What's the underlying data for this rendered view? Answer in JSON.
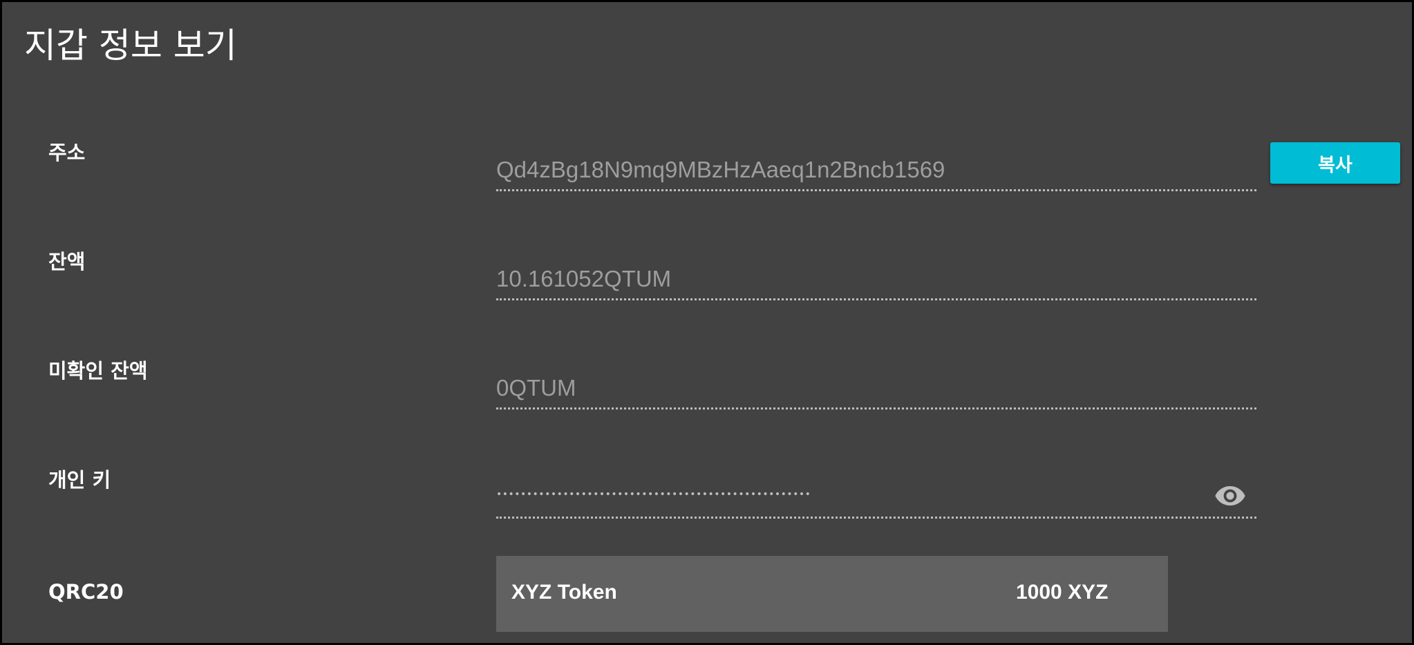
{
  "page": {
    "title": "지갑 정보 보기"
  },
  "address": {
    "label": "주소",
    "value": "Qd4zBg18N9mq9MBzHzAaeq1n2Bncb1569",
    "copy_label": "복사"
  },
  "balance": {
    "label": "잔액",
    "value": "10.161052QTUM"
  },
  "unconfirmed_balance": {
    "label": "미확인 잔액",
    "value": "0QTUM"
  },
  "private_key": {
    "label": "개인 키",
    "masked_value": "••••••••••••••••••••••••••••••••••••••••••••••••••••",
    "toggle_icon": "eye-icon"
  },
  "qrc20": {
    "label": "QRC20",
    "tokens": [
      {
        "name": "XYZ Token",
        "amount": "1000 XYZ"
      }
    ]
  },
  "colors": {
    "background": "#424242",
    "accent": "#00bcd4",
    "token_card": "#616161",
    "value_text": "#9e9e9e"
  }
}
